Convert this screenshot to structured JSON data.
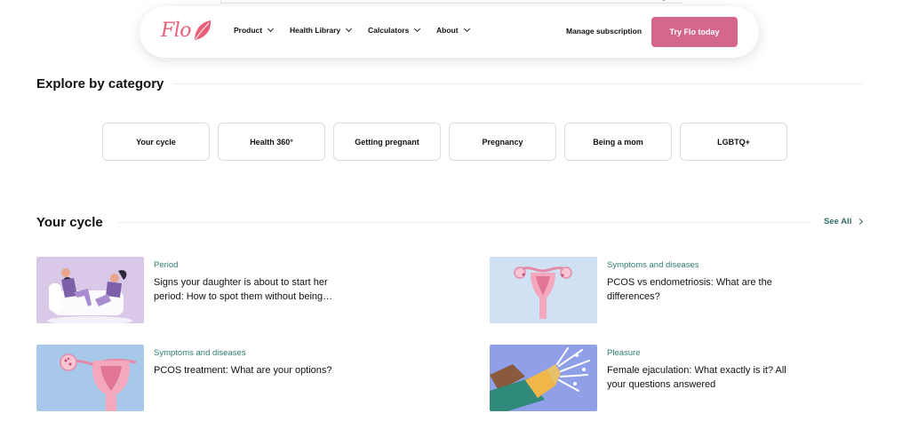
{
  "header": {
    "logo_text": "Flo",
    "nav": [
      {
        "label": "Product",
        "icon": "chevron-down-icon"
      },
      {
        "label": "Health Library",
        "icon": "chevron-down-icon"
      },
      {
        "label": "Calculators",
        "icon": "chevron-down-icon"
      },
      {
        "label": "About",
        "icon": "chevron-down-icon"
      }
    ],
    "manage_label": "Manage subscription",
    "cta_label": "Try Flo today"
  },
  "explore": {
    "title": "Explore by category",
    "categories": [
      "Your cycle",
      "Health 360°",
      "Getting pregnant",
      "Pregnancy",
      "Being a mom",
      "LGBTQ+"
    ]
  },
  "your_cycle": {
    "title": "Your cycle",
    "see_all": "See All",
    "articles": [
      {
        "tag": "Period",
        "title": "Signs your daughter is about to start her period: How to spot them without being…"
      },
      {
        "tag": "Symptoms and diseases",
        "title": "PCOS vs endometriosis: What are the differences?"
      },
      {
        "tag": "Symptoms and diseases",
        "title": "PCOS treatment: What are your options?"
      },
      {
        "tag": "Pleasure",
        "title": "Female ejaculation: What exactly is it? All your questions answered"
      }
    ]
  },
  "colors": {
    "brand": "#e8607a",
    "cta": "#d5688a",
    "tag": "#2f7a6f",
    "link": "#2f6b66"
  }
}
